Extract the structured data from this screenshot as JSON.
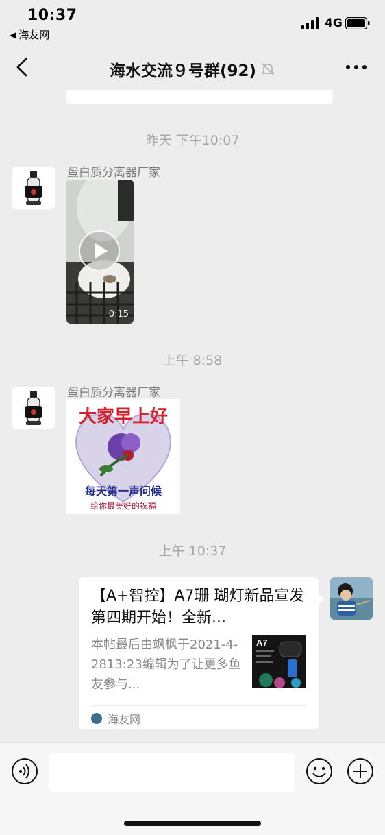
{
  "status_bar": {
    "time": "10:37",
    "back_app": "海友网",
    "network": "4G"
  },
  "nav": {
    "title": "海水交流９号群(92)"
  },
  "messages": {
    "ts1": "昨天 下午10:07",
    "ts2": "上午 8:58",
    "ts3": "上午 10:37",
    "sender1": "蛋白质分离器厂家",
    "sender2": "蛋白质分离器厂家",
    "video_duration": "0:15",
    "greeting_top": "大家早上好",
    "greeting_line1": "每天第一声问候",
    "greeting_line2": "给你最美好的祝福"
  },
  "link_card": {
    "title": "【A+智控】A7珊 瑚灯新品宣发 第四期开始！全新...",
    "desc": "本帖最后由飒枫于2021-4-2813:23编辑为了让更多鱼友参与...",
    "source": "海友网",
    "thumb_label": "A7"
  },
  "colors": {
    "background": "#ededed",
    "bubble": "#ffffff",
    "timestamp": "#a5a5a5"
  },
  "icons": [
    "signal-icon",
    "battery-icon",
    "back-chevron-icon",
    "mute-bell-icon",
    "more-dots-icon",
    "play-icon",
    "voice-icon",
    "emoji-icon",
    "plus-icon"
  ]
}
